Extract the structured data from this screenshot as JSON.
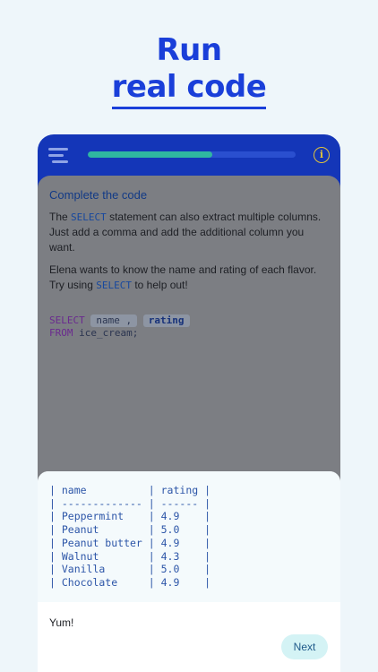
{
  "hero": {
    "line1": "Run",
    "line2": "real code"
  },
  "topbar": {
    "menu_icon": "menu-icon",
    "progress": 0.6,
    "info_icon": "info-icon",
    "info_glyph": "i"
  },
  "lesson": {
    "title": "Complete the code",
    "para1": {
      "pre": "The ",
      "kw": "SELECT",
      "post": " statement can also extract multiple columns. Just add a comma and add the additional column you want."
    },
    "para2": {
      "pre": "Elena wants to know the name and rating of each flavor. Try using ",
      "kw": "SELECT",
      "post": " to help out!"
    }
  },
  "code": {
    "kw_select": "SELECT",
    "blank1": "name ,",
    "blank2": "rating",
    "kw_from": "FROM",
    "from_rest": " ice_cream;"
  },
  "result": {
    "rows": [
      "| name          | rating |",
      "| ------------- | ------ |",
      "| Peppermint    | 4.9    |",
      "| Peanut        | 5.0    |",
      "| Peanut butter | 4.9    |",
      "| Walnut        | 4.3    |",
      "| Vanilla       | 5.0    |",
      "| Chocolate     | 4.9    |"
    ],
    "feedback": "Yum!",
    "next_label": "Next"
  },
  "colors": {
    "brand_blue": "#1436b8",
    "progress": "#2fb7a0",
    "info": "#e0c23c"
  }
}
